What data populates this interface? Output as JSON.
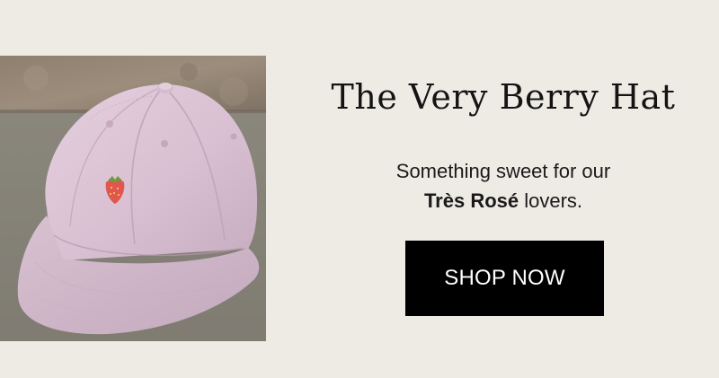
{
  "promo": {
    "headline": "The Very Berry Hat",
    "subhead_line1": "Something sweet for our",
    "subhead_brand": "Très Rosé",
    "subhead_line2_rest": " lovers.",
    "cta_label": "SHOP NOW"
  },
  "image": {
    "subject": "pink-baseball-cap-with-strawberry-embroidery"
  },
  "colors": {
    "background": "#eeebe5",
    "button": "#000000",
    "button_text": "#ffffff",
    "text": "#141414",
    "hat": "#d7bfd0"
  }
}
